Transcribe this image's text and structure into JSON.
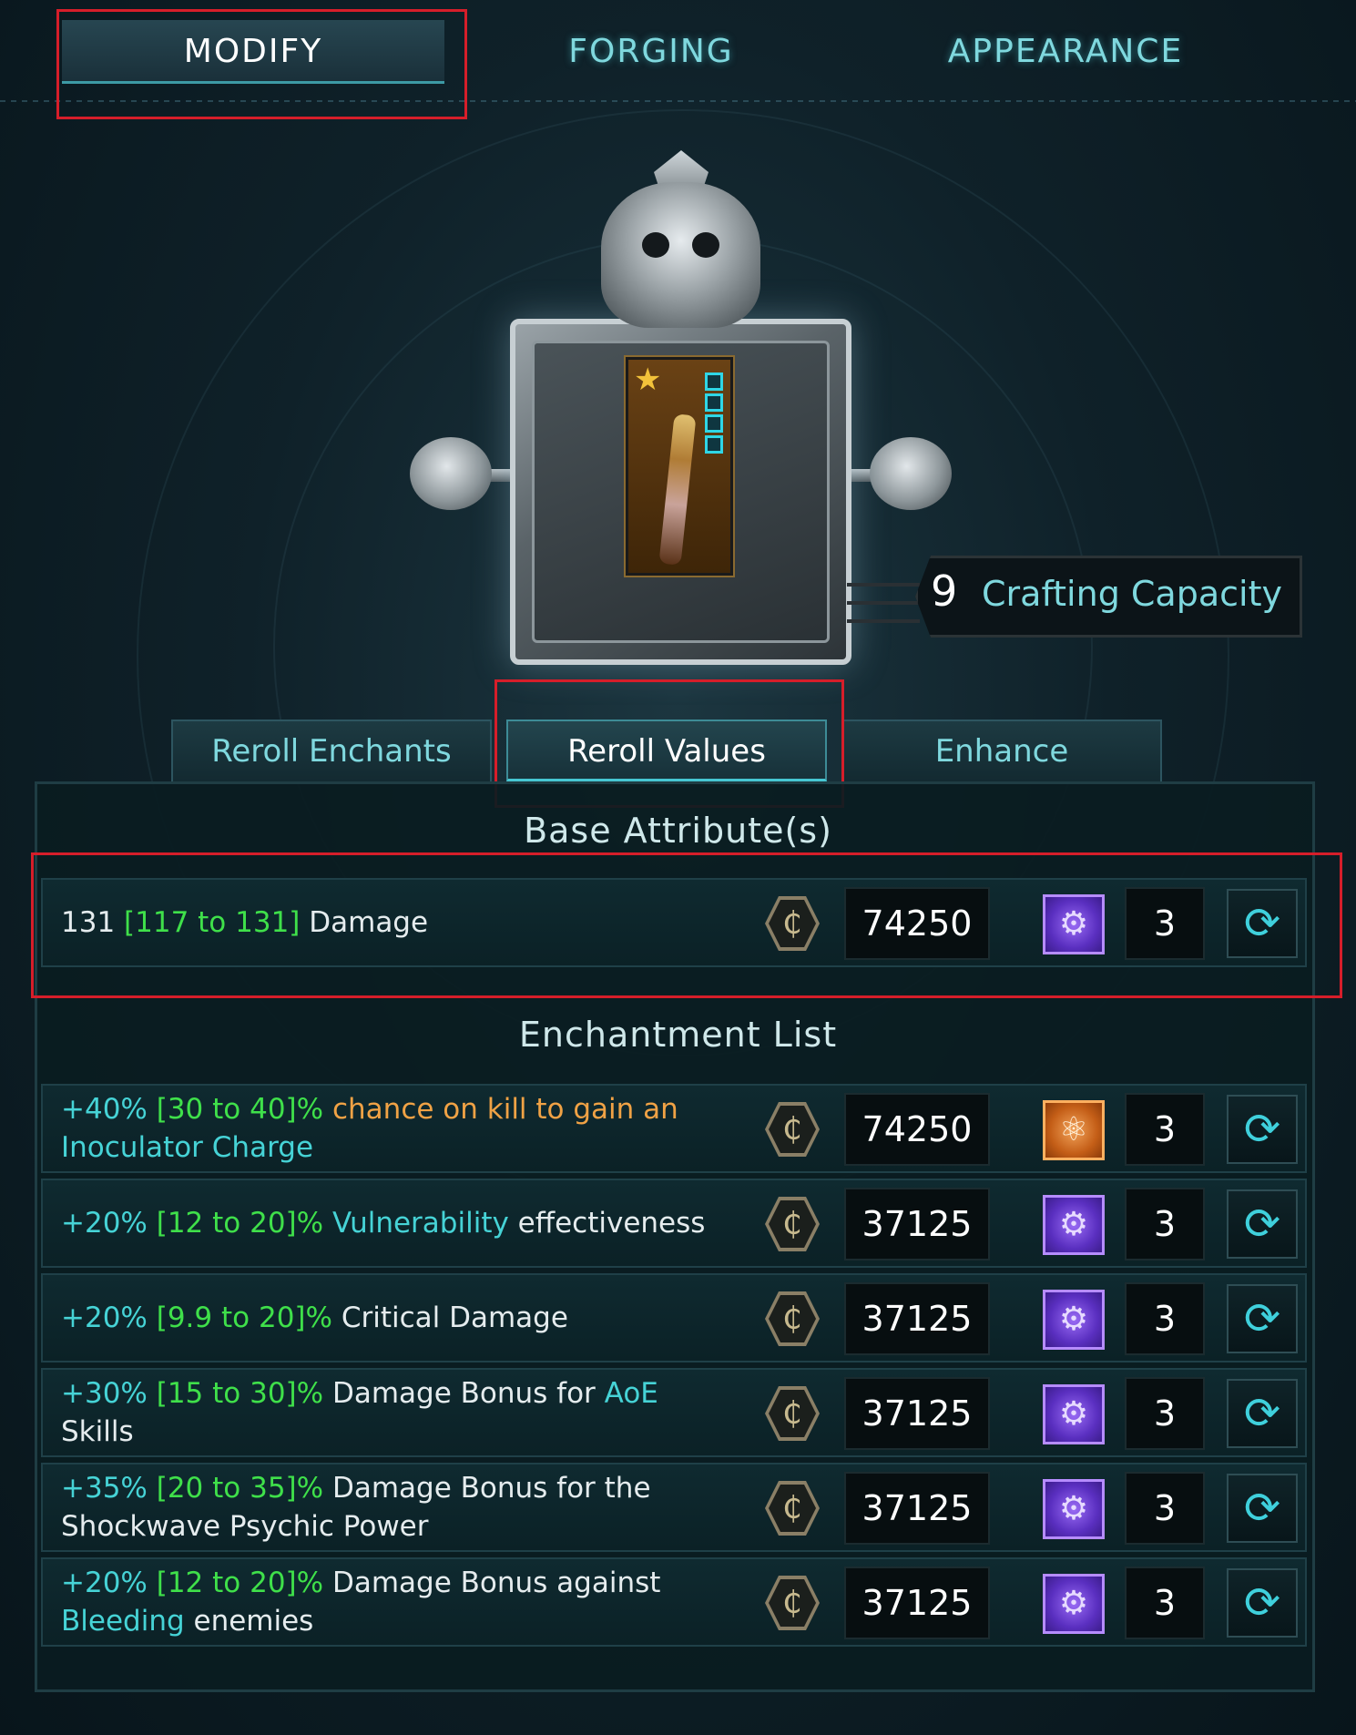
{
  "top_tabs": [
    {
      "label": "MODIFY",
      "active": true
    },
    {
      "label": "FORGING",
      "active": false
    },
    {
      "label": "APPEARANCE",
      "active": false
    }
  ],
  "crafting": {
    "capacity_value": "9",
    "capacity_label": "Crafting Capacity"
  },
  "sub_tabs": [
    {
      "label": "Reroll Enchants",
      "active": false
    },
    {
      "label": "Reroll Values",
      "active": true
    },
    {
      "label": "Enhance",
      "active": false
    }
  ],
  "base_section_title": "Base Attribute(s)",
  "enchant_section_title": "Enchantment List",
  "base_row": {
    "value": "131",
    "range": "[117 to 131]",
    "label": "Damage",
    "cost": "74250",
    "material": "purple-gear-icon",
    "quantity": "3"
  },
  "enchant_rows": [
    {
      "lines": [
        [
          {
            "t": "+40%",
            "c": "cyan"
          },
          {
            "t": " [30 to 40]%",
            "c": "green"
          },
          {
            "t": " chance on kill to gain an",
            "c": "orange"
          }
        ],
        [
          {
            "t": "Inoculator Charge",
            "c": "cyan"
          }
        ]
      ],
      "cost": "74250",
      "material": "orange-atom-icon",
      "quantity": "3"
    },
    {
      "lines": [
        [
          {
            "t": "+20%",
            "c": "cyan"
          },
          {
            "t": " [12 to 20]%",
            "c": "green"
          },
          {
            "t": " Vulnerability",
            "c": "cyan"
          },
          {
            "t": " effectiveness",
            "c": "white"
          }
        ]
      ],
      "cost": "37125",
      "material": "purple-gear-icon",
      "quantity": "3"
    },
    {
      "lines": [
        [
          {
            "t": "+20%",
            "c": "cyan"
          },
          {
            "t": " [9.9 to 20]%",
            "c": "green"
          },
          {
            "t": " Critical Damage",
            "c": "white"
          }
        ]
      ],
      "cost": "37125",
      "material": "purple-gear-icon",
      "quantity": "3"
    },
    {
      "lines": [
        [
          {
            "t": "+30%",
            "c": "cyan"
          },
          {
            "t": " [15 to 30]%",
            "c": "green"
          },
          {
            "t": " Damage Bonus for ",
            "c": "white"
          },
          {
            "t": "AoE",
            "c": "cyan"
          }
        ],
        [
          {
            "t": "Skills",
            "c": "white"
          }
        ]
      ],
      "cost": "37125",
      "material": "purple-gear-icon",
      "quantity": "3"
    },
    {
      "lines": [
        [
          {
            "t": "+35%",
            "c": "cyan"
          },
          {
            "t": " [20 to 35]%",
            "c": "green"
          },
          {
            "t": " Damage Bonus for the",
            "c": "white"
          }
        ],
        [
          {
            "t": "Shockwave Psychic Power",
            "c": "white"
          }
        ]
      ],
      "cost": "37125",
      "material": "purple-gear-icon",
      "quantity": "3"
    },
    {
      "lines": [
        [
          {
            "t": "+20%",
            "c": "cyan"
          },
          {
            "t": " [12 to 20]%",
            "c": "green"
          },
          {
            "t": " Damage Bonus against",
            "c": "white"
          }
        ],
        [
          {
            "t": "Bleeding",
            "c": "cyan"
          },
          {
            "t": " enemies",
            "c": "white"
          }
        ]
      ],
      "cost": "37125",
      "material": "purple-gear-icon",
      "quantity": "3"
    }
  ],
  "colors": {
    "cyan": "#46d3d6",
    "green": "#3fe04a",
    "orange": "#f0a245",
    "highlight": "#d61e2a"
  }
}
